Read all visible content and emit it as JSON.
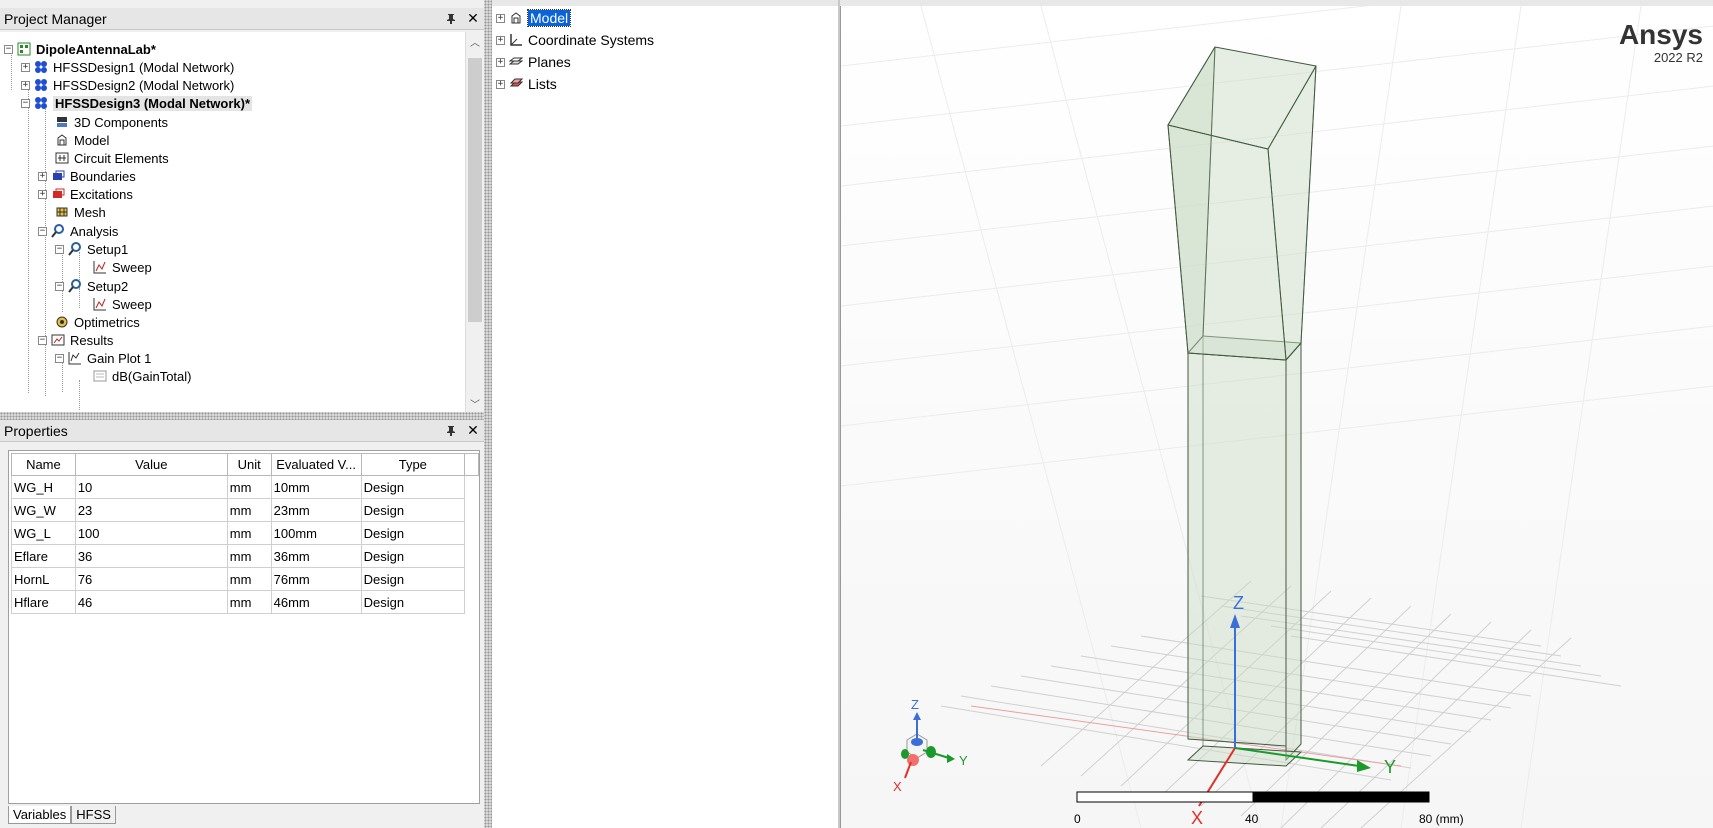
{
  "project_manager": {
    "title": "Project Manager",
    "pin_icon": "pin-icon",
    "close_icon": "close-icon",
    "tree": [
      {
        "label": "DipoleAntennaLab*",
        "icon": "project-icon"
      },
      {
        "label": "HFSSDesign1 (Modal Network)",
        "icon": "hfss-design-icon"
      },
      {
        "label": "HFSSDesign2 (Modal Network)",
        "icon": "hfss-design-icon"
      },
      {
        "label": "HFSSDesign3 (Modal Network)*",
        "icon": "hfss-design-icon"
      },
      {
        "label": "3D Components",
        "icon": "components-icon"
      },
      {
        "label": "Model",
        "icon": "model-icon"
      },
      {
        "label": "Circuit Elements",
        "icon": "circuit-icon"
      },
      {
        "label": "Boundaries",
        "icon": "boundaries-icon"
      },
      {
        "label": "Excitations",
        "icon": "excitations-icon"
      },
      {
        "label": "Mesh",
        "icon": "mesh-icon"
      },
      {
        "label": "Analysis",
        "icon": "analysis-icon"
      },
      {
        "label": "Setup1",
        "icon": "setup-icon"
      },
      {
        "label": "Sweep",
        "icon": "sweep-icon"
      },
      {
        "label": "Setup2",
        "icon": "setup-icon"
      },
      {
        "label": "Sweep",
        "icon": "sweep-icon"
      },
      {
        "label": "Optimetrics",
        "icon": "optimetrics-icon"
      },
      {
        "label": "Results",
        "icon": "results-icon"
      },
      {
        "label": "Gain Plot 1",
        "icon": "plot-icon"
      },
      {
        "label": "dB(GainTotal)",
        "icon": "trace-icon"
      }
    ]
  },
  "properties": {
    "title": "Properties",
    "columns": [
      "Name",
      "Value",
      "Unit",
      "Evaluated V...",
      "Type"
    ],
    "rows": [
      [
        "WG_H",
        "10",
        "mm",
        "10mm",
        "Design"
      ],
      [
        "WG_W",
        "23",
        "mm",
        "23mm",
        "Design"
      ],
      [
        "WG_L",
        "100",
        "mm",
        "100mm",
        "Design"
      ],
      [
        "Eflare",
        "36",
        "mm",
        "36mm",
        "Design"
      ],
      [
        "HornL",
        "76",
        "mm",
        "76mm",
        "Design"
      ],
      [
        "Hflare",
        "46",
        "mm",
        "46mm",
        "Design"
      ]
    ],
    "tabs": [
      "Variables",
      "HFSS"
    ]
  },
  "model_tree": [
    {
      "label": "Model",
      "icon": "model-icon",
      "selected": true
    },
    {
      "label": "Coordinate Systems",
      "icon": "coordinate-icon"
    },
    {
      "label": "Planes",
      "icon": "planes-icon"
    },
    {
      "label": "Lists",
      "icon": "lists-icon"
    }
  ],
  "viewport": {
    "brand": "Ansys",
    "version": "2022 R2",
    "axes": {
      "x": "X",
      "y": "Y",
      "z": "Z"
    },
    "scale": {
      "labels": [
        "0",
        "40",
        "80 (mm)"
      ]
    },
    "colors": {
      "x_axis": "#e0302a",
      "y_axis": "#1a9a2a",
      "z_axis": "#3a6fd8",
      "model_fill": "#c9dcc6",
      "selection": "#0a64d8"
    }
  }
}
